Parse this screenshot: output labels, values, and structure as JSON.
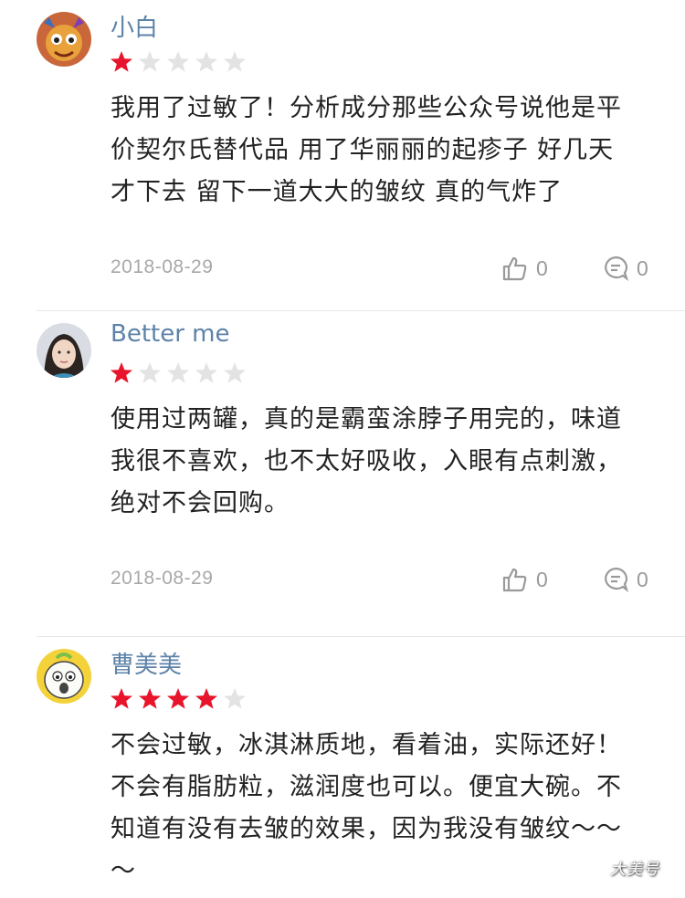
{
  "reviews": [
    {
      "username": "小白",
      "rating": 1,
      "max_rating": 5,
      "lines": [
        "我用了过敏了！分析成分那些公众号说他是平",
        "价契尔氏替代品 用了华丽丽的起疹子 好几天",
        "才下去 留下一道大大的皱纹 真的气炸了"
      ],
      "date": "2018-08-29",
      "likes": "0",
      "comments": "0"
    },
    {
      "username": "Better me",
      "rating": 1,
      "max_rating": 5,
      "lines": [
        "使用过两罐，真的是霸蛮涂脖子用完的，味道",
        "我很不喜欢，也不太好吸收，入眼有点刺激，",
        "绝对不会回购。"
      ],
      "date": "2018-08-29",
      "likes": "0",
      "comments": "0"
    },
    {
      "username": "曹美美",
      "rating": 4,
      "max_rating": 5,
      "lines": [
        "不会过敏，冰淇淋质地，看着油，实际还好！",
        "不会有脂肪粒，滋润度也可以。便宜大碗。不",
        "知道有没有去皱的效果，因为我没有皱纹～～",
        "～"
      ]
    }
  ],
  "watermark": "大美号",
  "colors": {
    "star_on": "#e8142b",
    "star_off": "#e3e3e3",
    "username": "#5d82a8",
    "meta": "#a8a8a8"
  }
}
